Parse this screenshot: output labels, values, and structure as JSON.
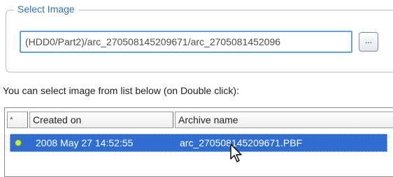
{
  "group": {
    "title": "Select Image"
  },
  "path_field": {
    "value": "(HDD0/Part2)/arc_270508145209671/arc_2705081452096"
  },
  "browse_button": {
    "label": "..."
  },
  "hint": {
    "text": "You can select image from list below (on Double click):"
  },
  "table": {
    "columns": {
      "marker": "*",
      "created_on": "Created on",
      "archive_name": "Archive name"
    },
    "rows": [
      {
        "status_icon": "green-dot-icon",
        "created_on": "2008 May 27 14:52:55",
        "archive_name": "arc_270508145209671.PBF",
        "selected": true
      }
    ]
  },
  "colors": {
    "legend": "#2f6fb8",
    "selection": "#2f6ed0",
    "status_dot": "#c6e84a"
  }
}
